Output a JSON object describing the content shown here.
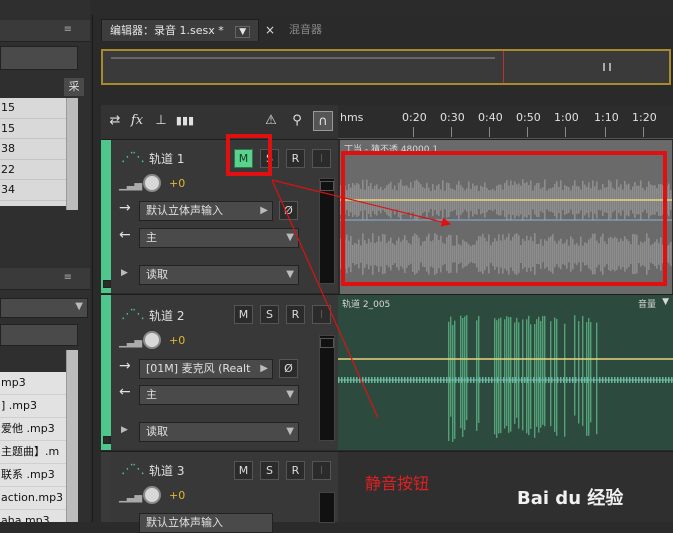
{
  "left_panel": {
    "col_label": "采",
    "numbers": [
      "15",
      "15",
      "38",
      "22",
      "34"
    ],
    "files": [
      "mp3",
      "] .mp3",
      "爱他 .mp3",
      "主题曲】.m",
      "联系 .mp3",
      "action.mp3",
      "aha.mp3"
    ]
  },
  "tabs": {
    "editor": "编辑器：录音 1.sesx *",
    "editor_dropdown": "▼",
    "close": "×",
    "mixer": "混音器"
  },
  "toolbar": {
    "icons": [
      "swap-icon",
      "fx-icon",
      "send-icon",
      "eq-icon"
    ],
    "right_icons": [
      "metronome-icon",
      "input-monitor-icon",
      "headphones-icon"
    ]
  },
  "ruler": {
    "unit": "hms",
    "ticks": [
      "0:20",
      "0:30",
      "0:40",
      "0:50",
      "1:00",
      "1:10",
      "1:20"
    ]
  },
  "tracks": [
    {
      "name": "轨道 1",
      "m": "M",
      "s": "S",
      "r": "R",
      "i": "I",
      "volume": "+0",
      "input": "默认立体声输入",
      "output": "主",
      "mode": "读取",
      "clip_label": "丁当 - 猜不透 48000 1"
    },
    {
      "name": "轨道 2",
      "m": "M",
      "s": "S",
      "r": "R",
      "i": "I",
      "volume": "+0",
      "input": "[01M] 麦克风 (Realt",
      "output": "主",
      "mode": "读取",
      "clip_label": "轨道 2_005",
      "clip_right": "音量"
    },
    {
      "name": "轨道 3",
      "m": "M",
      "s": "S",
      "r": "R",
      "i": "I",
      "volume": "+0",
      "input": "默认立体声输入"
    }
  ],
  "annotation": "静音按钮",
  "watermark": "Bai du 经验",
  "colors": {
    "accent_green": "#4ec68c",
    "highlight_red": "#e01010",
    "volume_yellow": "#e3b82c",
    "wave_gray": "#8e8e8e",
    "wave_green": "#5fbf8c"
  }
}
